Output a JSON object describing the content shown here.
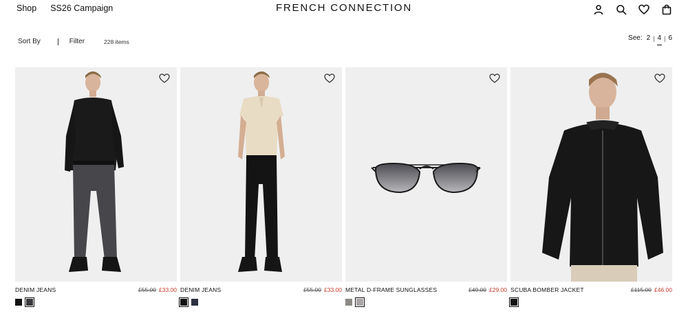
{
  "nav": {
    "shop_label": "Shop",
    "campaign_label": "SS26 Campaign",
    "brand": "FRENCH CONNECTION",
    "icons": [
      "account-icon",
      "search-icon",
      "heart-icon",
      "bag-icon"
    ]
  },
  "toolbar": {
    "sort_label": "Sort By",
    "filter_label": "Filter",
    "item_count": "228 items",
    "see_label": "See:",
    "grid_options": [
      "2",
      "4",
      "6"
    ],
    "grid_selected": "4"
  },
  "products": [
    {
      "name": "DENIM JEANS",
      "old_price": "£55.00",
      "new_price": "£33.00",
      "swatches": [
        {
          "color": "#111111",
          "selected": false
        },
        {
          "color": "#3a3a3e",
          "selected": true
        }
      ]
    },
    {
      "name": "DENIM JEANS",
      "old_price": "£55.00",
      "new_price": "£33.00",
      "swatches": [
        {
          "color": "#111111",
          "selected": true
        },
        {
          "color": "#2c3140",
          "selected": false
        }
      ]
    },
    {
      "name": "METAL D-FRAME SUNGLASSES",
      "old_price": "£49.00",
      "new_price": "£29.00",
      "swatches": [
        {
          "color": "#8d8a85",
          "selected": false
        },
        {
          "color": "#a9a4a6",
          "selected": true
        }
      ]
    },
    {
      "name": "SCUBA BOMBER JACKET",
      "old_price": "£115.00",
      "new_price": "£46.00",
      "swatches": [
        {
          "color": "#111111",
          "selected": true
        }
      ]
    }
  ],
  "colors": {
    "sale_price": "#c63b2b",
    "image_bg": "#efefef"
  }
}
